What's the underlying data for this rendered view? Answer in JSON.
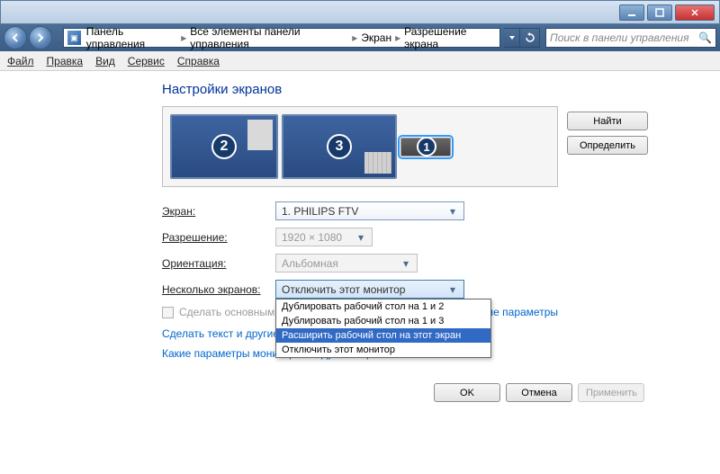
{
  "window": {
    "breadcrumbs": [
      "Панель управления",
      "Все элементы панели управления",
      "Экран",
      "Разрешение экрана"
    ],
    "search_placeholder": "Поиск в панели управления"
  },
  "menu": {
    "file": "Файл",
    "edit": "Правка",
    "view": "Вид",
    "service": "Сервис",
    "help": "Справка"
  },
  "page": {
    "title": "Настройки экранов",
    "find_btn": "Найти",
    "identify_btn": "Определить",
    "display_label": "Экран:",
    "display_value": "1. PHILIPS FTV",
    "resolution_label": "Разрешение:",
    "resolution_value": "1920 × 1080",
    "orientation_label": "Ориентация:",
    "orientation_value": "Альбомная",
    "multi_label": "Несколько экранов:",
    "multi_value": "Отключить этот монитор",
    "multi_options": [
      "Дублировать рабочий стол на 1 и 2",
      "Дублировать рабочий стол на 1 и 3",
      "Расширить рабочий стол на этот экран",
      "Отключить этот монитор"
    ],
    "selected_option_index": 2,
    "make_primary": "Сделать основным",
    "advanced": "Дополнительные параметры",
    "text_link_cut": "Сделать текст и другие",
    "which_monitor": "Какие параметры монитора следует выбрать?",
    "ok": "OK",
    "cancel": "Отмена",
    "apply": "Применить",
    "monitors": [
      {
        "num": "2"
      },
      {
        "num": "3"
      },
      {
        "num": "1"
      }
    ]
  }
}
